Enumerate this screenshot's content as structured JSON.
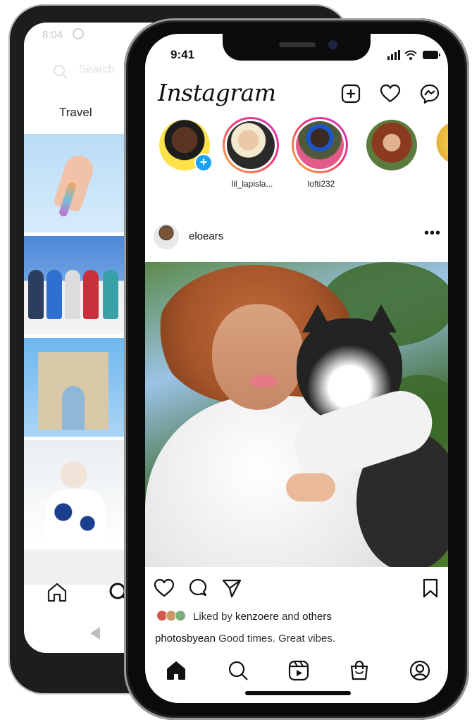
{
  "back_phone": {
    "status_time": "8:04",
    "search_placeholder": "Search",
    "tab_label": "Travel"
  },
  "front_phone": {
    "status_time": "9:41",
    "brand": "Instagram",
    "icons": {
      "new_post": "plus-square-icon",
      "activity": "heart-icon",
      "messenger": "messenger-icon"
    },
    "stories": [
      {
        "username": "",
        "own_story": true
      },
      {
        "username": "lil_lapisla...",
        "own_story": false
      },
      {
        "username": "lofti232",
        "own_story": false
      },
      {
        "username": "",
        "own_story": false
      },
      {
        "username": "",
        "own_story": false
      }
    ],
    "post": {
      "username": "eloears",
      "liked_prefix": "Liked by",
      "liked_user": "kenzoere",
      "liked_and": "and",
      "liked_others": "others",
      "caption_user": "photosbyean",
      "caption_text": "Good times. Great vibes."
    },
    "tabs": [
      "home-icon",
      "search-icon",
      "reels-icon",
      "shop-icon",
      "profile-icon"
    ]
  },
  "colors": {
    "story_gradient_start": "#fdb433",
    "story_gradient_mid": "#f63575",
    "story_gradient_end": "#c13bc4",
    "add_story_badge": "#19a4f4"
  }
}
